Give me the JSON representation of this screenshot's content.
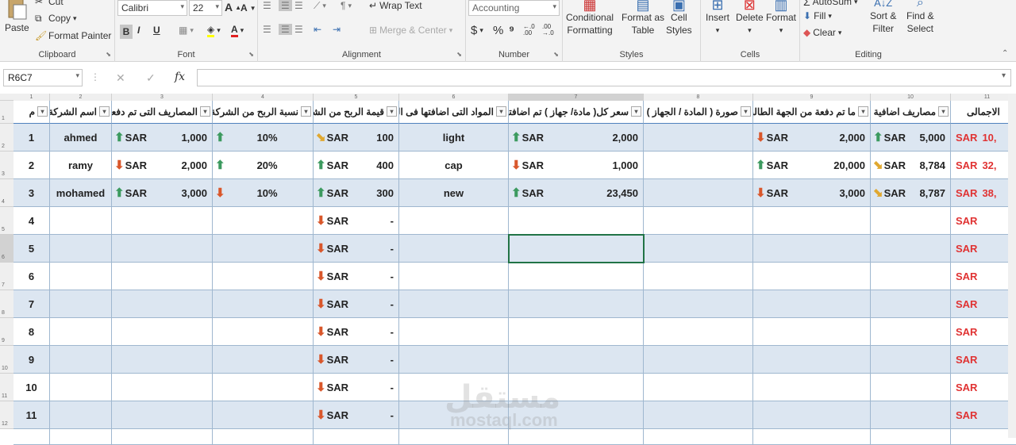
{
  "ribbon": {
    "clipboard": {
      "paste": "Paste",
      "cut": "Cut",
      "copy": "Copy",
      "format_painter": "Format Painter",
      "label": "Clipboard"
    },
    "font": {
      "name": "Calibri",
      "size": "22",
      "bold": "B",
      "italic": "I",
      "underline": "U",
      "label": "Font"
    },
    "alignment": {
      "wrap": "Wrap Text",
      "merge": "Merge & Center",
      "label": "Alignment"
    },
    "number": {
      "format": "Accounting",
      "currency": "$",
      "percent": "%",
      "comma": "⁹",
      "label": "Number"
    },
    "styles": {
      "conditional": "Conditional",
      "conditional2": "Formatting",
      "format_table": "Format as",
      "format_table2": "Table",
      "cell_styles": "Cell",
      "cell_styles2": "Styles",
      "label": "Styles"
    },
    "cells": {
      "insert": "Insert",
      "delete": "Delete",
      "format": "Format",
      "label": "Cells"
    },
    "editing": {
      "autosum": "AutoSum",
      "fill": "Fill",
      "clear": "Clear",
      "sort": "Sort &",
      "sort2": "Filter",
      "find": "Find &",
      "find2": "Select",
      "label": "Editing"
    }
  },
  "formula_bar": {
    "name_box": "R6C7",
    "fx": "fx",
    "content": ""
  },
  "col_numbers": [
    "1",
    "2",
    "3",
    "4",
    "5",
    "6",
    "7",
    "8",
    "9",
    "10",
    "11"
  ],
  "row_numbers": [
    "1",
    "2",
    "3",
    "4",
    "5",
    "6",
    "7",
    "8",
    "9",
    "10",
    "11",
    "12"
  ],
  "headers": [
    "م",
    "اسم الشركة",
    "المصاريف التى تم دفعها للشركة",
    "نسبة الربح من الشركة (%)",
    "قيمة الربح من الشركة",
    "المواد التى اضافتها فى المعرض",
    "سعر كل( مادة/ جهاز ) تم اضافتها",
    "صورة ( المادة / الجهاز )",
    "ما تم دفعة من الجهة الطالبة",
    "مصاريف اضافية",
    "الاجمالى"
  ],
  "currency": "SAR",
  "rows": [
    {
      "n": "1",
      "company": "ahmed",
      "paid": "1,000",
      "paid_arrow": "up",
      "pct": "10%",
      "pct_arrow": "up",
      "profit": "100",
      "profit_arrow": "side",
      "item": "light",
      "price": "2,000",
      "price_arrow": "up",
      "demand": "2,000",
      "demand_arrow": "down",
      "extra": "5,000",
      "extra_arrow": "up",
      "total": "10,"
    },
    {
      "n": "2",
      "company": "ramy",
      "paid": "2,000",
      "paid_arrow": "down",
      "pct": "20%",
      "pct_arrow": "up",
      "profit": "400",
      "profit_arrow": "up",
      "item": "cap",
      "price": "1,000",
      "price_arrow": "down",
      "demand": "20,000",
      "demand_arrow": "up",
      "extra": "8,784",
      "extra_arrow": "side",
      "total": "32,"
    },
    {
      "n": "3",
      "company": "mohamed",
      "paid": "3,000",
      "paid_arrow": "up",
      "pct": "10%",
      "pct_arrow": "down",
      "profit": "300",
      "profit_arrow": "up",
      "item": "new",
      "price": "23,450",
      "price_arrow": "up",
      "demand": "3,000",
      "demand_arrow": "down",
      "extra": "8,787",
      "extra_arrow": "side",
      "total": "38,"
    },
    {
      "n": "4",
      "profit": "-"
    },
    {
      "n": "5",
      "profit": "-"
    },
    {
      "n": "6",
      "profit": "-"
    },
    {
      "n": "7",
      "profit": "-"
    },
    {
      "n": "8",
      "profit": "-"
    },
    {
      "n": "9",
      "profit": "-"
    },
    {
      "n": "10",
      "profit": "-"
    },
    {
      "n": "11",
      "profit": "-"
    }
  ],
  "watermark": {
    "ar": "مستقل",
    "en": "mostaql.com"
  }
}
